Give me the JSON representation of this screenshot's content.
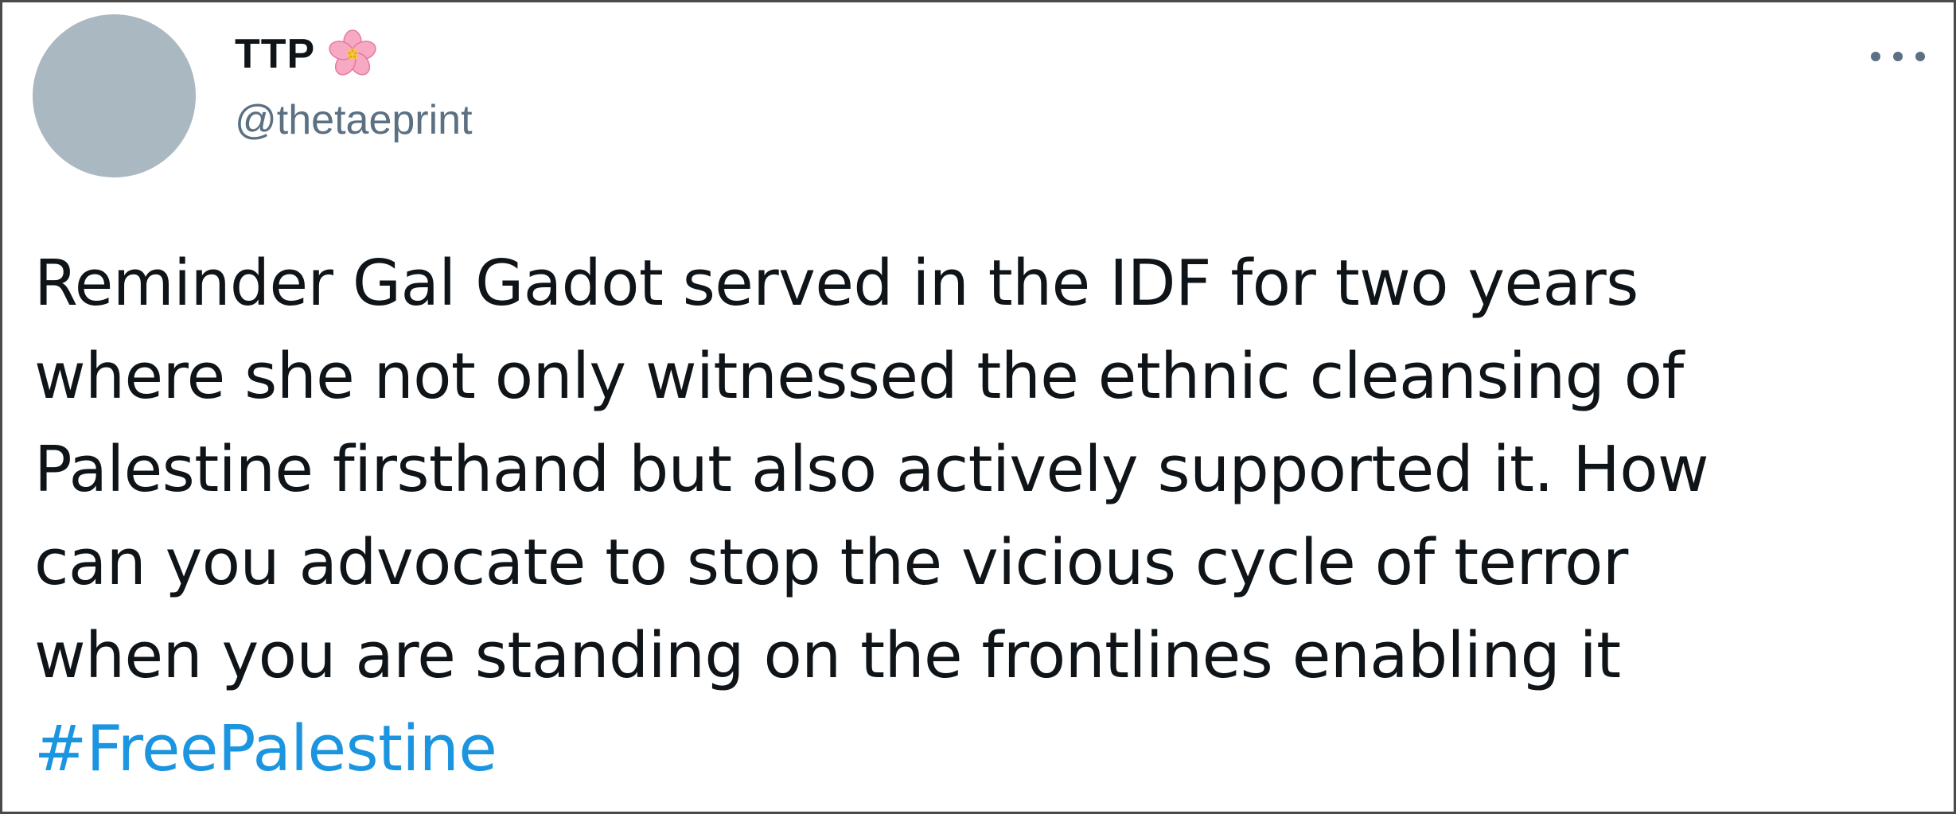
{
  "tweet": {
    "author": {
      "display_name": "TTP",
      "emoji_icon": "cherry-blossom-icon",
      "handle": "@thetaeprint"
    },
    "more_icon": "more-horizontal-icon",
    "text_lines": [
      "Reminder Gal Gadot served in the IDF for two years",
      "where she not only witnessed the ethnic cleansing of",
      "Palestine firsthand but also actively supported it. How",
      "can you advocate to stop the vicious cycle of terror",
      "when you are standing on the frontlines enabling it"
    ],
    "hashtag": "#FreePalestine"
  },
  "colors": {
    "avatar": "#aab8c2",
    "text": "#0f1419",
    "handle": "#5b7083",
    "hashtag": "#1b95e0",
    "flower_petal": "#f7a9c4",
    "flower_center": "#f5c842",
    "border": "#4a4a4a"
  }
}
